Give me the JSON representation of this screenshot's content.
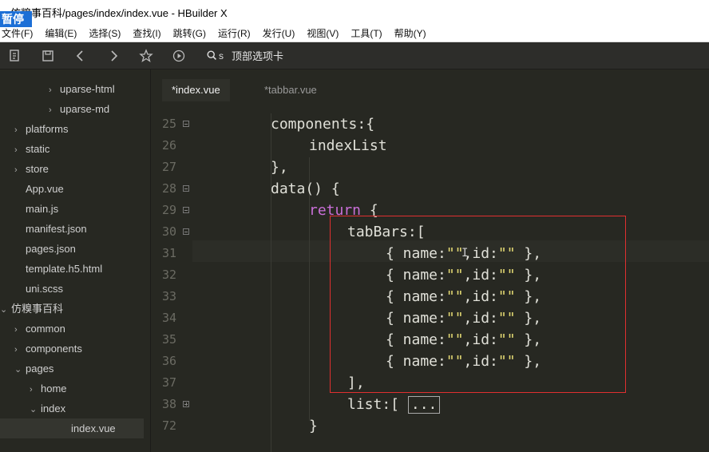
{
  "window": {
    "title": "仿糗事百科/pages/index/index.vue - HBuilder X",
    "logo_text": "暂停"
  },
  "menu": [
    "文件(F)",
    "编辑(E)",
    "选择(S)",
    "查找(I)",
    "跳转(G)",
    "运行(R)",
    "发行(U)",
    "视图(V)",
    "工具(T)",
    "帮助(Y)"
  ],
  "toolbar": {
    "icons": [
      "new-file-icon",
      "save-icon",
      "back-icon",
      "forward-icon",
      "star-icon",
      "run-icon",
      "search-icon"
    ],
    "search_shortcut": "s",
    "search_placeholder": "顶部选项卡"
  },
  "tree": [
    {
      "label": "uparse-html",
      "chevron": "›",
      "level": 2
    },
    {
      "label": "uparse-md",
      "chevron": "›",
      "level": 2
    },
    {
      "label": "platforms",
      "chevron": "›",
      "level": 0
    },
    {
      "label": "static",
      "chevron": "›",
      "level": 0
    },
    {
      "label": "store",
      "chevron": "›",
      "level": 0
    },
    {
      "label": "App.vue",
      "chevron": "",
      "level": 0
    },
    {
      "label": "main.js",
      "chevron": "",
      "level": 0
    },
    {
      "label": "manifest.json",
      "chevron": "",
      "level": 0
    },
    {
      "label": "pages.json",
      "chevron": "",
      "level": 0
    },
    {
      "label": "template.h5.html",
      "chevron": "",
      "level": 0
    },
    {
      "label": "uni.scss",
      "chevron": "",
      "level": 0
    },
    {
      "label": "仿糗事百科",
      "chevron": "⌄",
      "level": -1
    },
    {
      "label": "common",
      "chevron": "›",
      "level": 0
    },
    {
      "label": "components",
      "chevron": "›",
      "level": 0
    },
    {
      "label": "pages",
      "chevron": "⌄",
      "level": 0
    },
    {
      "label": "home",
      "chevron": "›",
      "level": 1
    },
    {
      "label": "index",
      "chevron": "⌄",
      "level": 1
    },
    {
      "label": "index.vue",
      "chevron": "",
      "level": 2,
      "selected": true
    }
  ],
  "tabs": [
    {
      "label": "*index.vue",
      "active": true
    },
    {
      "label": "*tabbar.vue",
      "active": false
    }
  ],
  "code": [
    {
      "num": "25",
      "fold": "minus",
      "indent": 0,
      "segments": [
        {
          "t": "components:{",
          "c": "fn"
        }
      ]
    },
    {
      "num": "26",
      "fold": "",
      "indent": 1,
      "segments": [
        {
          "t": "indexList",
          "c": "fn"
        }
      ]
    },
    {
      "num": "27",
      "fold": "",
      "indent": 0,
      "segments": [
        {
          "t": "},",
          "c": "fn"
        }
      ]
    },
    {
      "num": "28",
      "fold": "minus",
      "indent": 0,
      "segments": [
        {
          "t": "data() {",
          "c": "fn"
        }
      ]
    },
    {
      "num": "29",
      "fold": "minus",
      "indent": 1,
      "segments": [
        {
          "t": "return",
          "c": "kw"
        },
        {
          "t": " {",
          "c": "fn"
        }
      ]
    },
    {
      "num": "30",
      "fold": "minus",
      "indent": 2,
      "segments": [
        {
          "t": "tabBars:[",
          "c": "fn"
        }
      ]
    },
    {
      "num": "31",
      "fold": "",
      "indent": 3,
      "segments": [
        {
          "t": "{ name:",
          "c": "fn"
        },
        {
          "t": "\"\"",
          "c": "str"
        },
        {
          "t": ",id:",
          "c": "fn"
        },
        {
          "t": "\"\"",
          "c": "str"
        },
        {
          "t": " },",
          "c": "fn"
        }
      ]
    },
    {
      "num": "32",
      "fold": "",
      "indent": 3,
      "segments": [
        {
          "t": "{ name:",
          "c": "fn"
        },
        {
          "t": "\"\"",
          "c": "str"
        },
        {
          "t": ",id:",
          "c": "fn"
        },
        {
          "t": "\"\"",
          "c": "str"
        },
        {
          "t": " },",
          "c": "fn"
        }
      ]
    },
    {
      "num": "33",
      "fold": "",
      "indent": 3,
      "segments": [
        {
          "t": "{ name:",
          "c": "fn"
        },
        {
          "t": "\"\"",
          "c": "str"
        },
        {
          "t": ",id:",
          "c": "fn"
        },
        {
          "t": "\"\"",
          "c": "str"
        },
        {
          "t": " },",
          "c": "fn"
        }
      ]
    },
    {
      "num": "34",
      "fold": "",
      "indent": 3,
      "segments": [
        {
          "t": "{ name:",
          "c": "fn"
        },
        {
          "t": "\"\"",
          "c": "str"
        },
        {
          "t": ",id:",
          "c": "fn"
        },
        {
          "t": "\"\"",
          "c": "str"
        },
        {
          "t": " },",
          "c": "fn"
        }
      ]
    },
    {
      "num": "35",
      "fold": "",
      "indent": 3,
      "segments": [
        {
          "t": "{ name:",
          "c": "fn"
        },
        {
          "t": "\"\"",
          "c": "str"
        },
        {
          "t": ",id:",
          "c": "fn"
        },
        {
          "t": "\"\"",
          "c": "str"
        },
        {
          "t": " },",
          "c": "fn"
        }
      ]
    },
    {
      "num": "36",
      "fold": "",
      "indent": 3,
      "segments": [
        {
          "t": "{ name:",
          "c": "fn"
        },
        {
          "t": "\"\"",
          "c": "str"
        },
        {
          "t": ",id:",
          "c": "fn"
        },
        {
          "t": "\"\"",
          "c": "str"
        },
        {
          "t": " },",
          "c": "fn"
        }
      ]
    },
    {
      "num": "37",
      "fold": "",
      "indent": 2,
      "segments": [
        {
          "t": "],",
          "c": "fn"
        }
      ]
    },
    {
      "num": "38",
      "fold": "plus",
      "indent": 2,
      "segments": [
        {
          "t": "list:[ ",
          "c": "fn"
        },
        {
          "t": "...",
          "c": "ellipsis"
        }
      ]
    },
    {
      "num": "72",
      "fold": "",
      "indent": 1,
      "segments": [
        {
          "t": "}",
          "c": "fn"
        }
      ]
    }
  ],
  "colors": {
    "editor_bg": "#272822",
    "keyword": "#c96fd8",
    "string": "#e6db74",
    "highlight_box": "#e03030"
  }
}
